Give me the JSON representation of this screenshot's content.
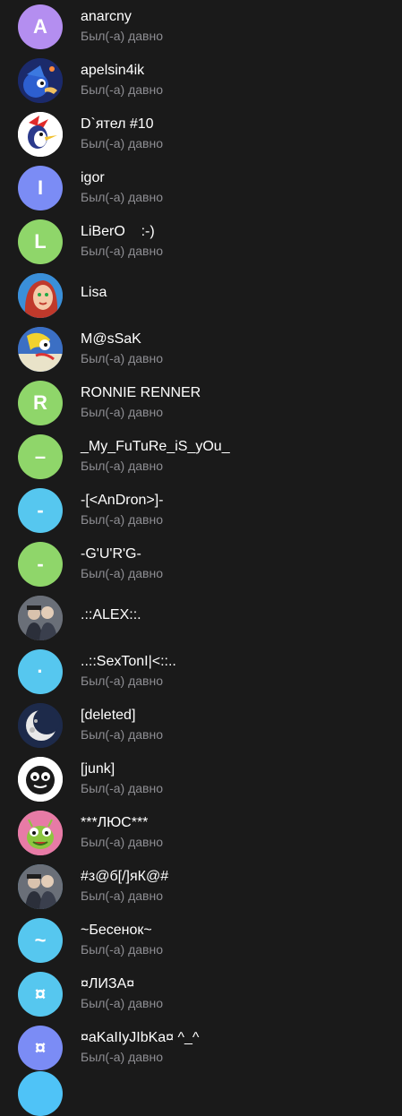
{
  "contacts": [
    {
      "name": "anarcny",
      "status": "Был(-а) давно",
      "letter": "A",
      "color": "#b48ef0",
      "icon": "letter-avatar"
    },
    {
      "name": "apelsin4ik",
      "status": "Был(-а) давно",
      "letter": "",
      "color": "#1b2a6b",
      "icon": "sonic-avatar"
    },
    {
      "name": "D`ятел #10",
      "status": "Был(-а) давно",
      "letter": "",
      "color": "#ffffff",
      "icon": "woodpecker-avatar"
    },
    {
      "name": "igor",
      "status": "Был(-а) давно",
      "letter": "I",
      "color": "#7b8cf5",
      "icon": "letter-avatar"
    },
    {
      "name": "LiBerO    :-)",
      "status": "Был(-а) давно",
      "letter": "L",
      "color": "#8fd66a",
      "icon": "letter-avatar"
    },
    {
      "name": "Lisa",
      "status": "",
      "letter": "",
      "color": "#3a8fd9",
      "icon": "cartoon-girl-avatar"
    },
    {
      "name": "M@sSaK",
      "status": "Был(-а) давно",
      "letter": "",
      "color": "#3b6fc4",
      "icon": "cartoon-avatar"
    },
    {
      "name": "RONNIE RENNER",
      "status": "Был(-а) давно",
      "letter": "R",
      "color": "#8fd66a",
      "icon": "letter-avatar"
    },
    {
      "name": "_My_FuTuRe_iS_yOu_",
      "status": "Был(-а) давно",
      "letter": "–",
      "color": "#8fd66a",
      "icon": "letter-avatar"
    },
    {
      "name": "-[<AnDron>]-",
      "status": "Был(-а) давно",
      "letter": "-",
      "color": "#56c7ef",
      "icon": "letter-avatar"
    },
    {
      "name": "-G'U'R'G-",
      "status": "Был(-а) давно",
      "letter": "-",
      "color": "#8fd66a",
      "icon": "letter-avatar"
    },
    {
      "name": ".::ALEX::.",
      "status": "",
      "letter": "",
      "color": "#6a6f78",
      "icon": "photo-avatar"
    },
    {
      "name": "..::SexTonI|<::..",
      "status": "Был(-а) давно",
      "letter": "·",
      "color": "#56c7ef",
      "icon": "letter-avatar"
    },
    {
      "name": "[deleted]",
      "status": "Был(-а) давно",
      "letter": "",
      "color": "#1d2a4a",
      "icon": "moon-avatar"
    },
    {
      "name": "[junk]",
      "status": "Был(-а) давно",
      "letter": "",
      "color": "#ffffff",
      "icon": "fuzzy-monster-avatar"
    },
    {
      "name": "***ЛЮС***",
      "status": "Был(-а) давно",
      "letter": "",
      "color": "#e77ba6",
      "icon": "alien-avatar"
    },
    {
      "name": "#з@б[/]яК@#",
      "status": "Был(-а) давно",
      "letter": "",
      "color": "#4aa3d8",
      "icon": "photo-avatar"
    },
    {
      "name": "~Бесенок~",
      "status": "Был(-а) давно",
      "letter": "~",
      "color": "#56c7ef",
      "icon": "letter-avatar"
    },
    {
      "name": "¤ЛИЗА¤",
      "status": "Был(-а) давно",
      "letter": "¤",
      "color": "#56c7ef",
      "icon": "letter-avatar"
    },
    {
      "name": "¤aKaIIyJIbKa¤ ^_^",
      "status": "Был(-а) давно",
      "letter": "¤",
      "color": "#7b8cf5",
      "icon": "letter-avatar"
    }
  ]
}
